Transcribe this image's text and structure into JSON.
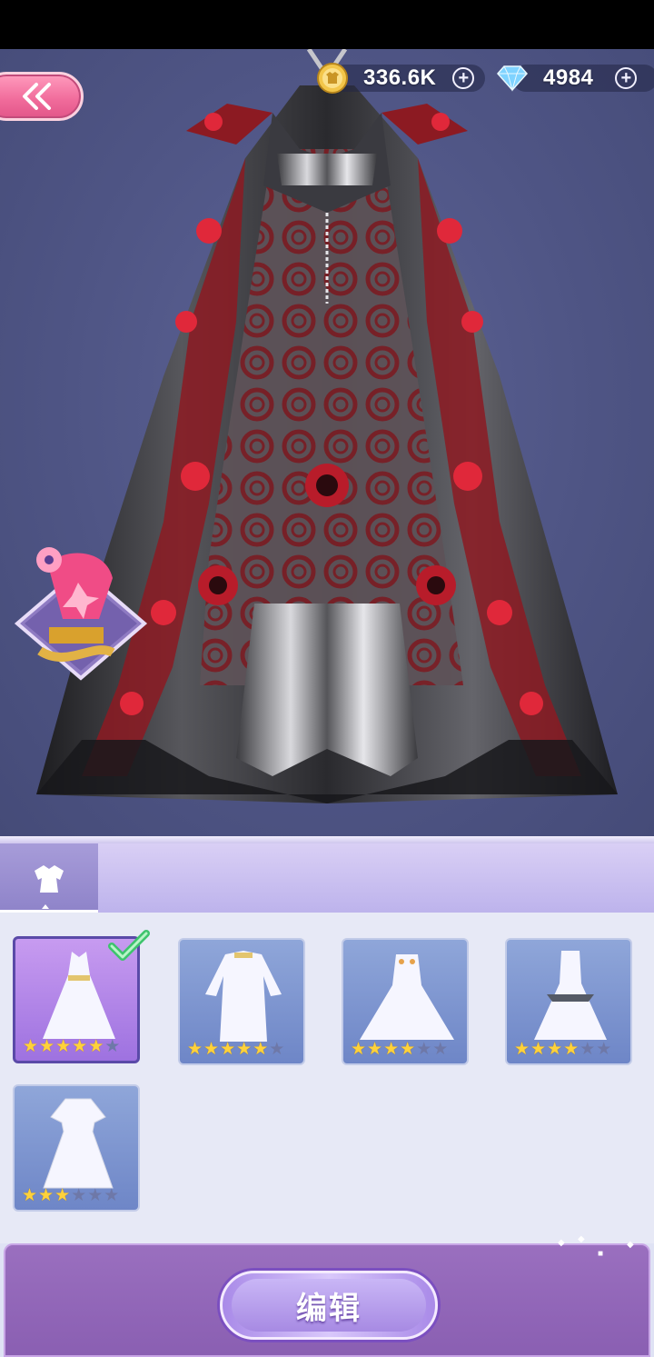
{
  "header": {
    "gold": {
      "value": "336.6K",
      "icon": "gold-coin-icon"
    },
    "diamonds": {
      "value": "4984",
      "icon": "diamond-icon"
    }
  },
  "category": {
    "selected": "dress-category-icon"
  },
  "items": [
    {
      "stars": 5,
      "max_stars": 6,
      "selected": true
    },
    {
      "stars": 5,
      "max_stars": 6,
      "selected": false
    },
    {
      "stars": 4,
      "max_stars": 6,
      "selected": false
    },
    {
      "stars": 4,
      "max_stars": 6,
      "selected": false
    },
    {
      "stars": 3,
      "max_stars": 6,
      "selected": false
    }
  ],
  "footer": {
    "edit_label": "编辑"
  },
  "colors": {
    "accent_pink": "#f06a9a",
    "panel_purple": "#8a5fb2",
    "card_blue": "#7f96d0",
    "card_selected": "#b385ea",
    "star_on": "#ffd23a"
  }
}
